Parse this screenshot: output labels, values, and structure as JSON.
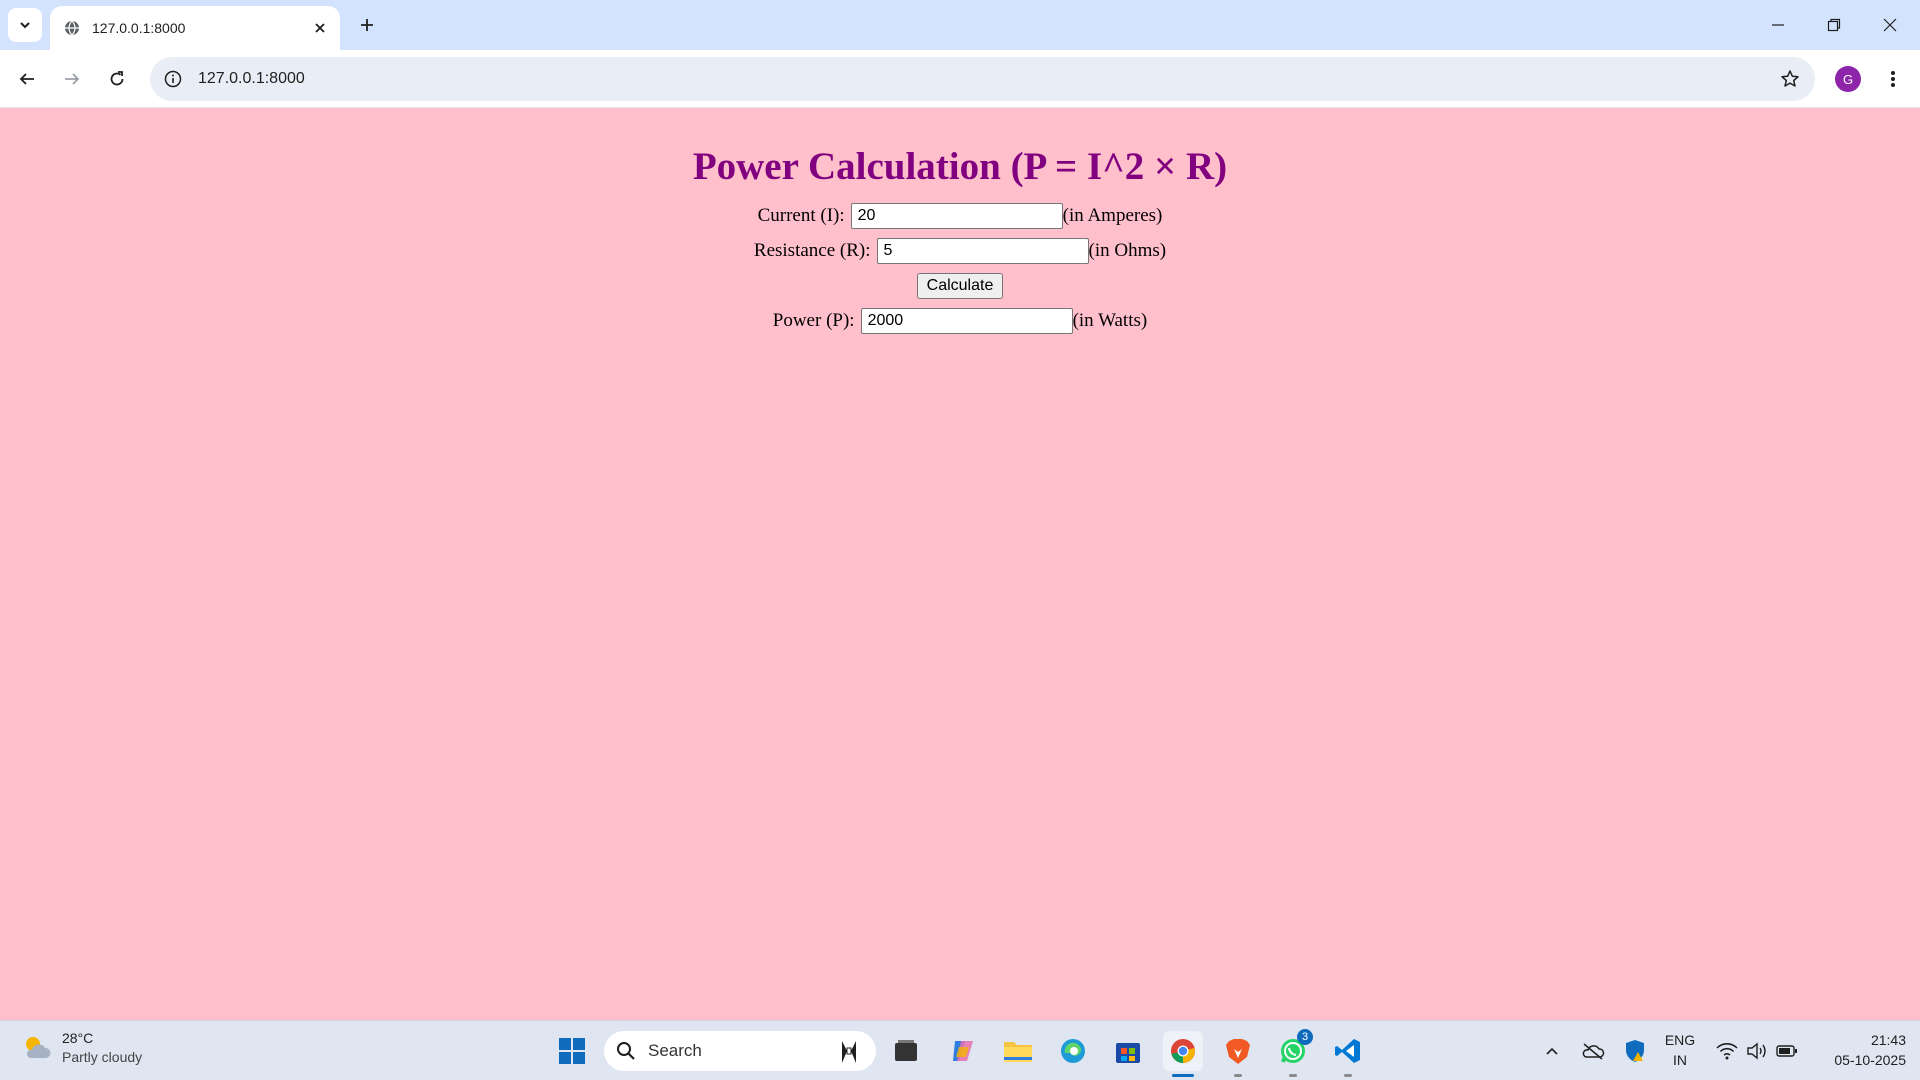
{
  "browser": {
    "tab_title": "127.0.0.1:8000",
    "url": "127.0.0.1:8000",
    "profile_initial": "G"
  },
  "page": {
    "title": "Power Calculation (P = I^2 × R)",
    "current": {
      "label": "Current (I):",
      "value": "20",
      "unit": "(in Amperes)"
    },
    "resistance": {
      "label": "Resistance (R):",
      "value": "5",
      "unit": "(in Ohms)"
    },
    "calculate_label": "Calculate",
    "power": {
      "label": "Power (P):",
      "value": "2000",
      "unit": "(in Watts)"
    }
  },
  "taskbar": {
    "weather_temp": "28°C",
    "weather_desc": "Partly cloudy",
    "search_placeholder": "Search",
    "whatsapp_badge": "3",
    "lang_line1": "ENG",
    "lang_line2": "IN",
    "time": "21:43",
    "date": "05-10-2025"
  },
  "colors": {
    "page_background": "#ffc0cb",
    "title_color": "#800080",
    "tabstrip": "#d3e3fd",
    "taskbar": "#dfe6f1"
  }
}
